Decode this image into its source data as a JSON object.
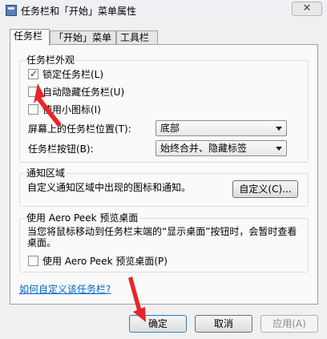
{
  "window": {
    "title": "任务栏和「开始」菜单属性",
    "close_glyph": "✕"
  },
  "tabs": [
    {
      "label": "任务栏",
      "selected": true
    },
    {
      "label": "「开始」菜单",
      "selected": false
    },
    {
      "label": "工具栏",
      "selected": false
    }
  ],
  "appearance": {
    "title": "任务栏外观",
    "lock_taskbar": {
      "label": "锁定任务栏(L)",
      "checked": true
    },
    "auto_hide": {
      "label": "自动隐藏任务栏(U)",
      "checked": false
    },
    "small_icons": {
      "label": "使用小图标(I)",
      "checked": false
    },
    "location": {
      "label": "屏幕上的任务栏位置(T):",
      "value": "底部"
    },
    "buttons": {
      "label": "任务栏按钮(B):",
      "value": "始终合并、隐藏标签"
    }
  },
  "notification": {
    "title": "通知区域",
    "description": "自定义通知区域中出现的图标和通知。",
    "customize_button": "自定义(C)..."
  },
  "peek": {
    "title": "使用 Aero Peek 预览桌面",
    "description": "当您将鼠标移动到任务栏末端的“显示桌面”按钮时，会暂时查看桌面。",
    "checkbox": {
      "label": "使用 Aero Peek 预览桌面(P)",
      "checked": false
    }
  },
  "help_link": "如何自定义该任务栏?",
  "footer": {
    "ok": "确定",
    "cancel": "取消",
    "apply": "应用(A)"
  },
  "colors": {
    "annotation_arrow": "#e8242a",
    "link": "#0066cc"
  }
}
